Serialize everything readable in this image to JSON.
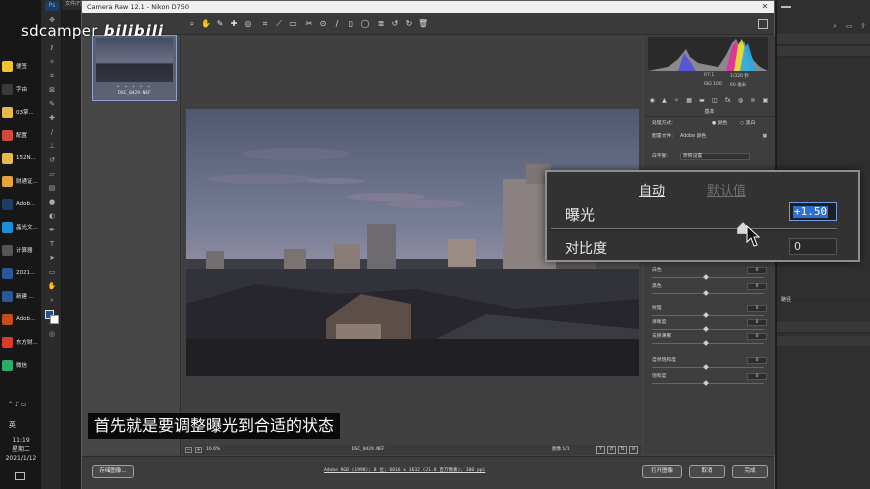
{
  "watermark": {
    "user": "sdcamper",
    "brand": "bilibili"
  },
  "subtitle": "首先就是要调整曝光到合适的状态",
  "taskbar": {
    "apps": [
      {
        "label": "便签",
        "icon": "sticky-notes-icon",
        "color": "#f2c230"
      },
      {
        "label": "字由",
        "icon": "ziyou-icon",
        "color": "#3a3a3a"
      },
      {
        "label": "03掌...",
        "icon": "folder-icon",
        "color": "#e8b84a"
      },
      {
        "label": "配置",
        "icon": "config-icon",
        "color": "#d24a3a"
      },
      {
        "label": "152N...",
        "icon": "folder-icon",
        "color": "#e8b84a"
      },
      {
        "label": "财通证...",
        "icon": "stock-icon",
        "color": "#e8a23a"
      },
      {
        "label": "Adob...",
        "icon": "photoshop-icon",
        "color": "#1b3d66"
      },
      {
        "label": "晶光文...",
        "icon": "edge-icon",
        "color": "#1b8fd8"
      },
      {
        "label": "计算器",
        "icon": "calculator-icon",
        "color": "#555555"
      },
      {
        "label": "2021...",
        "icon": "word-icon",
        "color": "#2b579a"
      },
      {
        "label": "新建 ...",
        "icon": "word-icon",
        "color": "#2b579a"
      },
      {
        "label": "Adob...",
        "icon": "illustrator-icon",
        "color": "#c64b16"
      },
      {
        "label": "东方财...",
        "icon": "eastmoney-icon",
        "color": "#d93a2b"
      },
      {
        "label": "微信",
        "icon": "wechat-icon",
        "color": "#2aae67"
      }
    ],
    "time": "11:19",
    "weekday": "星期二",
    "date": "2021/1/12",
    "ime": "英"
  },
  "photoshop": {
    "menu_label": "文件(F)",
    "ps_badge": "Ps"
  },
  "camera_raw": {
    "title": "Camera Raw 12.1 - Nikon D750",
    "thumbnail": {
      "filename": "DSC_0429.NEF",
      "stars": "• • • • •"
    },
    "preview_bar": {
      "zoom": "16.6%",
      "filename": "DSC_0429.NEF",
      "image_count": "图像 1/1",
      "view_buttons": [
        "Y",
        "⇄",
        "⇅",
        "≡"
      ]
    },
    "bottom": {
      "save_button": "存储图像...",
      "workflow_link": "Adobe RGB (1998); 8 位; 6016 x 3632 (21.8 百万像素); 300 ppi",
      "open_button": "打开图像",
      "cancel_button": "取消",
      "done_button": "完成"
    },
    "exif": {
      "aperture": "f/7.1",
      "shutter": "1/320 秒",
      "iso": "ISO 100",
      "focal": "60 毫米"
    },
    "panel": {
      "title": "基本",
      "process_label": "处理方式:",
      "process_color": "颜色",
      "process_bw": "黑白",
      "profile_label": "配置文件:",
      "profile_value": "Adobe 颜色",
      "wb_label": "白平衡:",
      "wb_value": "原照设置",
      "rows": [
        {
          "label": "白色",
          "value": "0"
        },
        {
          "label": "黑色",
          "value": "0"
        },
        {
          "label": "纹理",
          "value": "0"
        },
        {
          "label": "清晰度",
          "value": "0"
        },
        {
          "label": "去除薄雾",
          "value": "0"
        },
        {
          "label": "自然饱和度",
          "value": "0"
        },
        {
          "label": "饱和度",
          "value": "0"
        }
      ]
    },
    "zoom_popup": {
      "tab_auto": "自动",
      "tab_default": "默认值",
      "exposure_label": "曝光",
      "exposure_value": "+1.50",
      "exposure_level": 0.62,
      "contrast_label": "对比度",
      "contrast_value": "0"
    }
  },
  "ps_dock": {
    "paths_label": "路径"
  },
  "colors": {
    "accent_blue": "#2f6fd0",
    "ps_dark": "#2b2b2b",
    "cr_bg": "#434343"
  }
}
